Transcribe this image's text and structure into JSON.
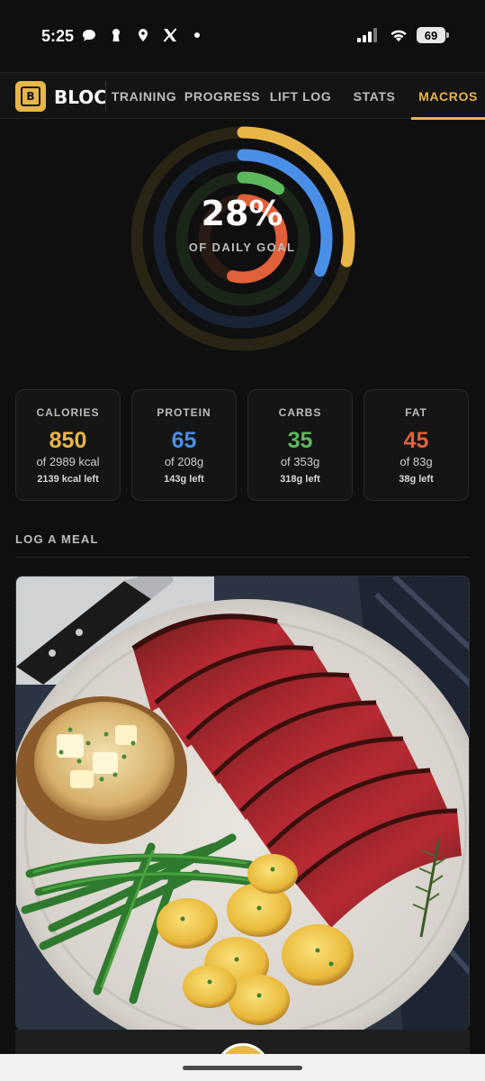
{
  "status_bar": {
    "time": "5:25",
    "battery": "69",
    "icons": [
      "chat-bubble-icon",
      "keyhole-icon",
      "location-pin-icon",
      "x-logo-icon",
      "dot-icon",
      "signal-icon",
      "wifi-icon",
      "battery-icon"
    ]
  },
  "header": {
    "brand": "BLOC",
    "logo_text": "B",
    "tabs": [
      {
        "label": "TRAINING",
        "active": false
      },
      {
        "label": "PROGRESS",
        "active": false
      },
      {
        "label": "LIFT LOG",
        "active": false
      },
      {
        "label": "STATS",
        "active": false
      },
      {
        "label": "MACROS",
        "active": true
      }
    ]
  },
  "donut": {
    "percent_label": "28%",
    "sub_label": "OF DAILY GOAL",
    "rings": [
      {
        "name": "calories",
        "fraction": 0.284,
        "color": "#e8b648"
      },
      {
        "name": "protein",
        "fraction": 0.3125,
        "color": "#4a8fe7"
      },
      {
        "name": "carbs",
        "fraction": 0.099,
        "color": "#5cb85c"
      },
      {
        "name": "fat",
        "fraction": 0.542,
        "color": "#e0603a"
      }
    ]
  },
  "macros": [
    {
      "label": "CALORIES",
      "value": "850",
      "of": "of 2989 kcal",
      "left": "2139 kcal left",
      "color": "#e8b648"
    },
    {
      "label": "PROTEIN",
      "value": "65",
      "of": "of 208g",
      "left": "143g left",
      "color": "#4a8fe7"
    },
    {
      "label": "CARBS",
      "value": "35",
      "of": "of 353g",
      "left": "318g left",
      "color": "#5cb85c"
    },
    {
      "label": "FAT",
      "value": "45",
      "of": "of 83g",
      "left": "38g left",
      "color": "#e0603a"
    }
  ],
  "log_meal": {
    "title": "LOG A MEAL",
    "photo_subject": "steak-dinner-photo"
  },
  "colors": {
    "accent": "#e8b648",
    "background": "#0f0f0f"
  }
}
